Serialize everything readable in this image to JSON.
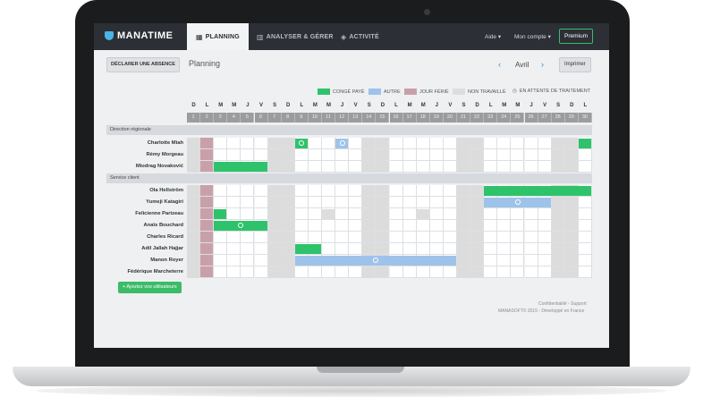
{
  "nav": {
    "logo": "MANATIME",
    "tabs": [
      {
        "label": "PLANNING",
        "icon": "calendar-icon"
      },
      {
        "label": "ANALYSER & GÉRER",
        "icon": "bar-chart-icon"
      },
      {
        "label": "ACTIVITÉ",
        "icon": "shield-icon"
      }
    ],
    "help": "Aide",
    "account": "Mon compte",
    "premium": "Premium"
  },
  "toolbar": {
    "declare": "DÉCLARER UNE ABSENCE",
    "title": "Planning",
    "month": "Avril",
    "print": "Imprimer"
  },
  "legend": [
    {
      "label": "CONGÉ PAYÉ",
      "color": "#2ec36b"
    },
    {
      "label": "AUTRE",
      "color": "#9ec3ea"
    },
    {
      "label": "JOUR FÉRIÉ",
      "color": "#c9a0a9"
    },
    {
      "label": "NON TRAVAILLÉ",
      "color": "#dddddd"
    },
    {
      "label": "EN ATTENTE DE TRAITEMENT",
      "color": "#555555"
    }
  ],
  "day_letters": [
    "D",
    "L",
    "M",
    "M",
    "J",
    "V",
    "S",
    "D",
    "L",
    "M",
    "M",
    "J",
    "V",
    "S",
    "D",
    "L",
    "M",
    "M",
    "J",
    "V",
    "S",
    "D",
    "L",
    "M",
    "M",
    "J",
    "V",
    "S",
    "D",
    "L"
  ],
  "day_numbers": [
    "1",
    "2",
    "3",
    "4",
    "5",
    "6",
    "7",
    "8",
    "9",
    "10",
    "11",
    "12",
    "13",
    "14",
    "15",
    "16",
    "17",
    "18",
    "19",
    "20",
    "21",
    "22",
    "23",
    "24",
    "25",
    "26",
    "27",
    "28",
    "29",
    "30"
  ],
  "groups": [
    {
      "name": "Direction régionale",
      "people": [
        "Charlotte Miah",
        "Rémy Morgeau",
        "Miodrag Novaković"
      ]
    },
    {
      "name": "Service client",
      "people": [
        "Ola Hellström",
        "Yumeji Katagiri",
        "Felicienne Parizeau",
        "Anaïs Bouchard",
        "Charles Ricard",
        "Adil Jallah Hajjar",
        "Manon Royer",
        "Fédérique Marcheterre"
      ]
    }
  ],
  "add_users": "+ Ajoutez vos utilisateurs",
  "footer": {
    "links": "Confidentialité - Support",
    "copyright": "MANASOFT© 2015 - Développé en France"
  }
}
